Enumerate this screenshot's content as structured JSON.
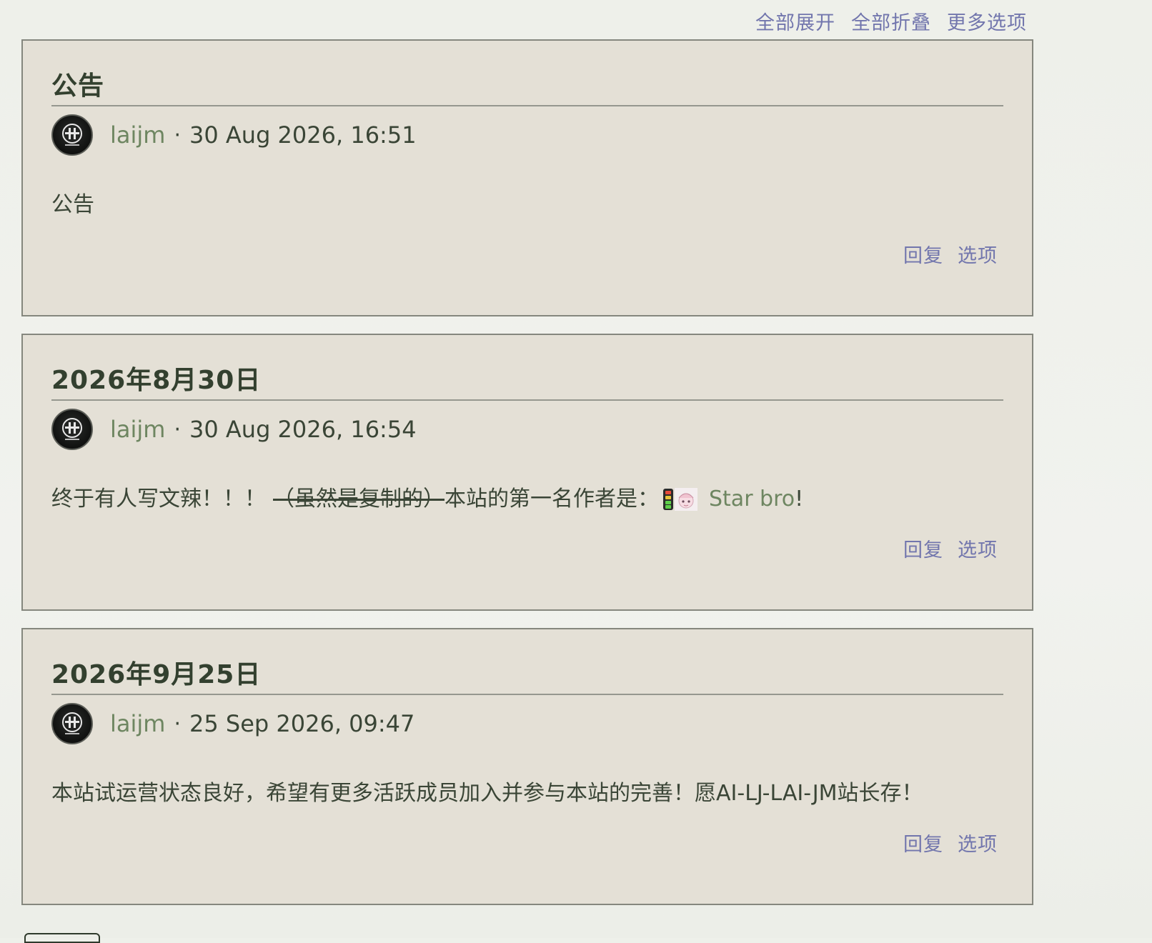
{
  "toolbar": {
    "expand_all": "全部展开",
    "collapse_all": "全部折叠",
    "more_options": "更多选项"
  },
  "posts": [
    {
      "title": "公告",
      "author": "laijm",
      "separator": "·",
      "timestamp": "30 Aug 2026, 16:51",
      "content": "公告",
      "reply_label": "回复",
      "options_label": "选项"
    },
    {
      "title": "2026年8月30日",
      "author": "laijm",
      "separator": "·",
      "timestamp": "30 Aug 2026, 16:54",
      "content_before": "终于有人写文辣！！！",
      "content_strike": "（虽然是复制的）",
      "content_after": "本站的第一名作者是：",
      "mention": "Star bro",
      "content_end": "!",
      "reply_label": "回复",
      "options_label": "选项"
    },
    {
      "title": "2026年9月25日",
      "author": "laijm",
      "separator": "·",
      "timestamp": "25 Sep 2026, 09:47",
      "content": "本站试运营状态良好，希望有更多活跃成员加入并参与本站的完善！愿AI-LJ-LAI-JM站长存！",
      "reply_label": "回复",
      "options_label": "选项"
    }
  ],
  "colors": {
    "link": "#7276ad",
    "author": "#6e8661",
    "card_bg": "#e4e0d6",
    "text": "#3a4536"
  },
  "icons": {
    "avatar": "logo-avatar-icon",
    "emoji_battery": "traffic-light-icon",
    "emoji_face": "anime-face-icon"
  }
}
